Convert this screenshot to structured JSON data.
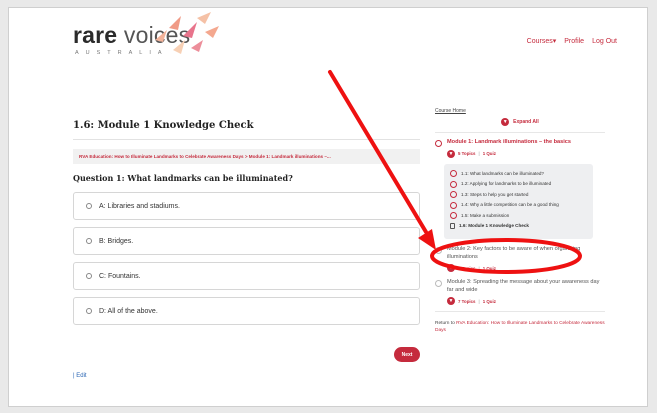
{
  "header": {
    "logo_main": "rare",
    "logo_second": "voices",
    "logo_sub": "AUSTRALIA",
    "nav": {
      "courses": "Courses",
      "courses_caret": "▾",
      "profile": "Profile",
      "logout": "Log Out"
    }
  },
  "main": {
    "title": "1.6: Module 1 Knowledge Check",
    "breadcrumb": "RVA Education: How to Illuminate Landmarks to Celebrate Awareness Days > Module 1: Landmark illuminations –...",
    "question": "Question 1: What landmarks can be illuminated?",
    "answers": [
      "A: Libraries and stadiums.",
      "B: Bridges.",
      "C: Fountains.",
      "D: All of the above."
    ],
    "next_label": "Next",
    "edit_label": "| Edit"
  },
  "sidebar": {
    "course_home": "Course Home",
    "expand_all": "Expand All",
    "modules": [
      {
        "title": "Module 1: Landmark illuminations – the basics",
        "topics_count": "5 Topics",
        "quiz_count": "1 Quiz",
        "topics": [
          "1.1: What landmarks can be illuminated?",
          "1.2: Applying for landmarks to be illuminated",
          "1.3: Steps to help you get started",
          "1.4: Why a little competition can be a good thing",
          "1.5: Make a submission"
        ],
        "quiz": "1.6: Module 1 Knowledge Check"
      },
      {
        "title": "Module 2: Key factors to be aware of when organising illuminations",
        "topics_count": "6 Topics",
        "quiz_count": "1 Quiz"
      },
      {
        "title": "Module 3: Spreading the message about your awareness day far and wide",
        "topics_count": "7 Topics",
        "quiz_count": "1 Quiz"
      }
    ],
    "return_prefix": "Return to",
    "return_link": "RVA Education: How to Illuminate Landmarks to Celebrate Awareness Days"
  },
  "colors": {
    "accent": "#c52b3d",
    "annotation": "#ee1111"
  }
}
